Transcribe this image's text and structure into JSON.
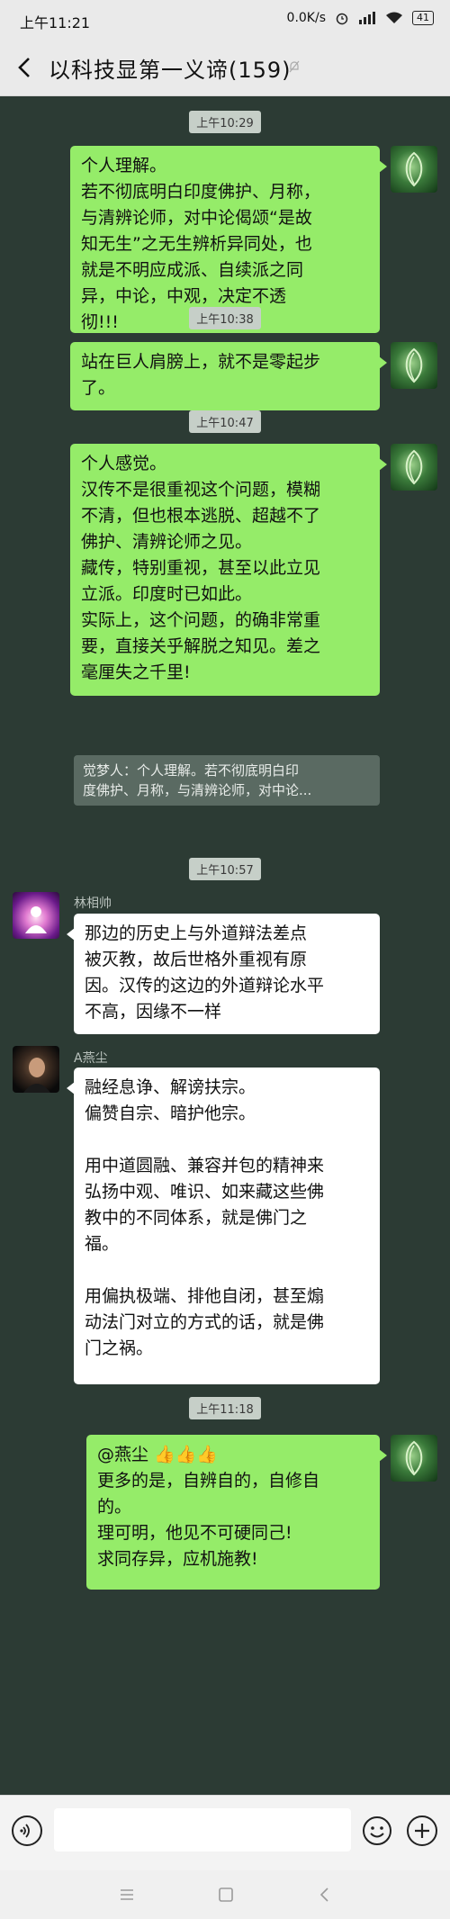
{
  "status_bar": {
    "time": "上午11:21",
    "net_speed": "0.0K/s",
    "battery": "41"
  },
  "header": {
    "title": "以科技显第一义谛(159)"
  },
  "messages": {
    "ts1": "上午10:29",
    "m1": [
      "个人理解。",
      "若不彻底明白印度佛护、月称，",
      "与清辨论师，对中论偈颂“是故",
      "知无生”之无生辨析异同处，也",
      "就是不明应成派、自续派之同",
      "异，中论，中观，决定不透",
      "彻!!!"
    ],
    "ts2": "上午10:38",
    "m2": [
      "站在巨人肩膀上，就不是零起步",
      "了。"
    ],
    "ts3": "上午10:47",
    "m3": [
      "个人感觉。",
      "汉传不是很重视这个问题，模糊",
      "不清，但也根本逃脱、超越不了",
      "佛护、清辨论师之见。",
      "藏传，特别重视，甚至以此立见",
      "立派。印度时已如此。",
      "实际上，这个问题，的确非常重",
      "要，直接关乎解脱之知见。差之",
      "毫厘失之千里!"
    ],
    "quote": [
      "觉梦人：个人理解。若不彻底明白印",
      "度佛护、月称，与清辨论师，对中论..."
    ],
    "ts4": "上午10:57",
    "sender4": "林相帅",
    "m4": [
      "那边的历史上与外道辩法差点",
      "被灭教，故后世格外重视有原",
      "因。汉传的这边的外道辩论水平",
      "不高，因缘不一样"
    ],
    "sender5": "A燕尘",
    "m5": [
      "融经息诤、解谤扶宗。",
      "偏赞自宗、暗护他宗。",
      "",
      "用中道圆融、兼容并包的精神来",
      "弘扬中观、唯识、如来藏这些佛",
      "教中的不同体系，就是佛门之",
      "福。",
      "",
      "用偏执极端、排他自闭，甚至煽",
      "动法门对立的方式的话，就是佛",
      "门之祸。"
    ],
    "ts6": "上午11:18",
    "m6": [
      "@燕尘 👍👍👍",
      "更多的是，自辨自的，自修自",
      "的。",
      "理可明，他见不可硬同己!",
      "求同存异，应机施教!"
    ]
  }
}
